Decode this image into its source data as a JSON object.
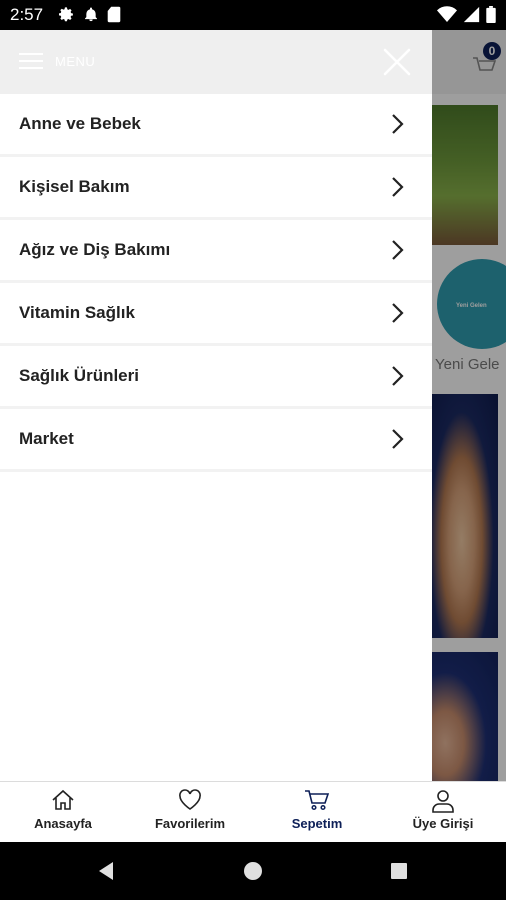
{
  "status_bar": {
    "time": "2:57",
    "left_icons": [
      "settings-icon",
      "notification-bell-icon",
      "sd-card-icon"
    ],
    "right_icons": [
      "wifi-icon",
      "signal-icon",
      "battery-icon"
    ]
  },
  "background": {
    "cart_count": "0",
    "promo_label": "Yeni Gele",
    "circle_text": "Yeni Gelen"
  },
  "drawer": {
    "title": "MENU",
    "items": [
      {
        "label": "Anne ve Bebek"
      },
      {
        "label": "Kişisel Bakım"
      },
      {
        "label": "Ağız ve Diş Bakımı"
      },
      {
        "label": "Vitamin Sağlık"
      },
      {
        "label": "Sağlık Ürünleri"
      },
      {
        "label": "Market"
      }
    ]
  },
  "bottom_nav": {
    "items": [
      {
        "label": "Anasayfa",
        "icon": "home-icon"
      },
      {
        "label": "Favorilerim",
        "icon": "heart-icon"
      },
      {
        "label": "Sepetim",
        "icon": "cart-icon",
        "active": true
      },
      {
        "label": "Üye Girişi",
        "icon": "user-icon"
      }
    ],
    "active_color": "#0d1f57"
  },
  "colors": {
    "brand": "#0d1f57",
    "drawer_header_bg": "#efefef"
  }
}
